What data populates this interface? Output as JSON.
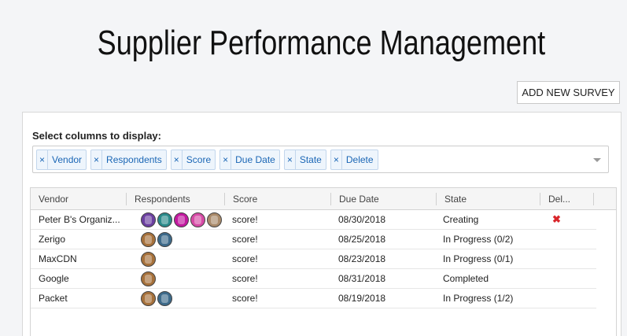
{
  "page": {
    "title": "Supplier Performance Management",
    "add_button": "ADD NEW SURVEY"
  },
  "column_selector": {
    "label": "Select columns to display:",
    "chips": [
      "Vendor",
      "Respondents",
      "Score",
      "Due Date",
      "State",
      "Delete"
    ],
    "remove_symbol": "×"
  },
  "table": {
    "headers": [
      "Vendor",
      "Respondents",
      "Score",
      "Due Date",
      "State",
      "Del..."
    ],
    "rows": [
      {
        "vendor": "Peter B's Organiz...",
        "respondents": [
          "purple-robot",
          "teal-robot",
          "magenta-robot",
          "pink-robot",
          "person-photo"
        ],
        "score": "score!",
        "due_date": "08/30/2018",
        "state": "Creating",
        "delete": "✖"
      },
      {
        "vendor": "Zerigo",
        "respondents": [
          "dog-photo",
          "blue-robot"
        ],
        "score": "score!",
        "due_date": "08/25/2018",
        "state": "In Progress (0/2)",
        "delete": ""
      },
      {
        "vendor": "MaxCDN",
        "respondents": [
          "dog-photo"
        ],
        "score": "score!",
        "due_date": "08/23/2018",
        "state": "In Progress (0/1)",
        "delete": ""
      },
      {
        "vendor": "Google",
        "respondents": [
          "dog-photo"
        ],
        "score": "score!",
        "due_date": "08/31/2018",
        "state": "Completed",
        "delete": ""
      },
      {
        "vendor": "Packet",
        "respondents": [
          "dog-photo",
          "blue-robot"
        ],
        "score": "score!",
        "due_date": "08/19/2018",
        "state": "In Progress (1/2)",
        "delete": ""
      }
    ]
  },
  "colors": {
    "chip_text": "#1a66b5",
    "delete_icon": "#d9262b",
    "avatar_palette": {
      "purple-robot": "#6b3fa0",
      "teal-robot": "#2b8a8a",
      "magenta-robot": "#c2189f",
      "pink-robot": "#d64aa5",
      "person-photo": "#a98a6a",
      "dog-photo": "#a6713b",
      "blue-robot": "#3d6a8a"
    }
  }
}
